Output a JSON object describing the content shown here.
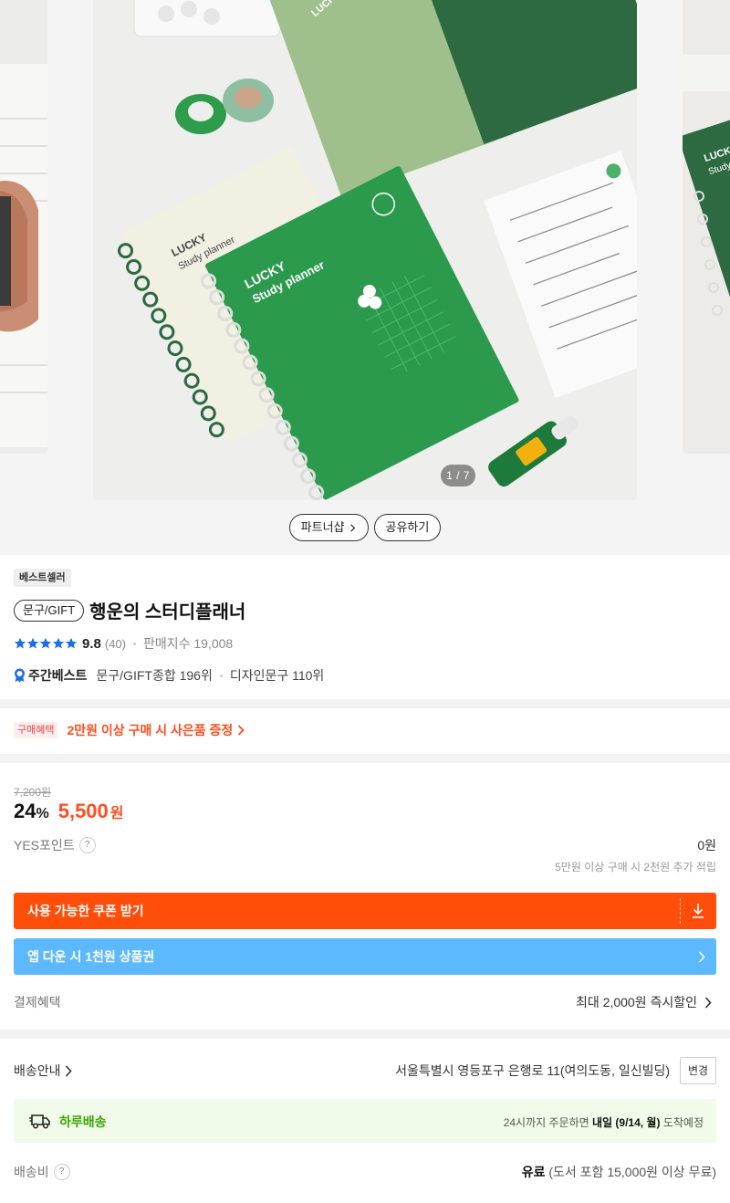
{
  "gallery": {
    "page_counter": "1 / 7",
    "cover_text": "LUCKY",
    "cover_subtext": "Study planner",
    "partner_shop_label": "파트너샵",
    "share_label": "공유하기"
  },
  "product": {
    "badge": "베스트셀러",
    "category": "문구/GIFT",
    "title": "행운의 스터디플래너",
    "rating_score": "9.8",
    "review_count": "(40)",
    "sales_index": "판매지수 19,008",
    "rank_title": "주간베스트",
    "rank_items": [
      "문구/GIFT종합 196위",
      "디자인문구 110위"
    ]
  },
  "benefit": {
    "tag": "구매혜택",
    "text": "2만원 이상 구매 시 사은품 증정"
  },
  "price": {
    "original": "7,200원",
    "discount": "24",
    "discount_unit": "%",
    "sale": "5,500",
    "sale_unit": "원",
    "points_label": "YES포인트",
    "points_value": "0원",
    "points_note": "5만원 이상 구매 시 2천원 추가 적립",
    "coupon_label": "사용 가능한 쿠폰 받기",
    "app_label": "앱 다운 시 1천원 상품권",
    "payment_label": "결제혜택",
    "payment_value": "최대 2,000원 즉시할인"
  },
  "shipping": {
    "label": "배송안내",
    "address": "서울특별시 영등포구 은행로 11(여의도동, 일신빌딩)",
    "change_label": "변경",
    "fast_title": "하루배송",
    "fast_prefix": "24시까지 주문하면",
    "fast_date": "내일 (9/14, 월)",
    "fast_suffix": "도착예정",
    "fee_label": "배송비",
    "fee_type": "유료",
    "fee_note": "(도서 포함 15,000원 이상 무료)"
  },
  "colors": {
    "accent_orange": "#ff4d0a",
    "app_blue": "#5cb8ff",
    "star_blue": "#1a6fe8",
    "fast_green": "#3ca500"
  }
}
